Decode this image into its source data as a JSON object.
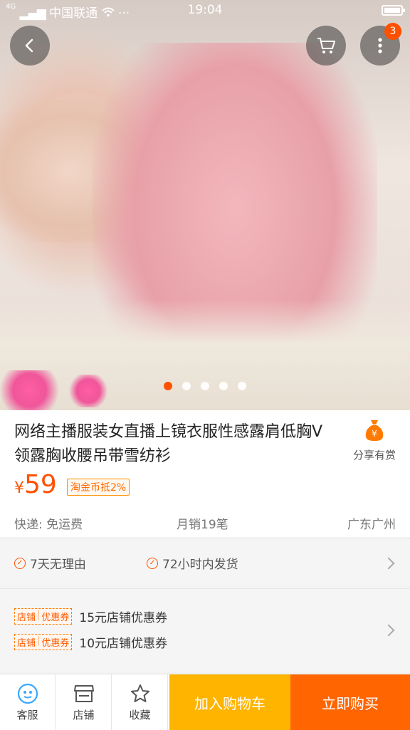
{
  "status_bar": {
    "carrier": "中国联通",
    "time": "19:04",
    "signal": "4G"
  },
  "header": {
    "cart_badge": "3"
  },
  "carousel": {
    "image_count": 5,
    "active_index": 0
  },
  "product": {
    "title": "网络主播服装女直播上镜衣服性感露肩低胸V领露胸收腰吊带雪纺衫",
    "currency_symbol": "¥",
    "price": "59",
    "coin_tag": "淘金币抵2%",
    "share_label": "分享有赏",
    "shipping": "快递: 免运费",
    "monthly_sales": "月销19笔",
    "location": "广东广州"
  },
  "guarantees": [
    {
      "label": "7天无理由"
    },
    {
      "label": "72小时内发货"
    }
  ],
  "coupons": {
    "tag_left": "店铺",
    "tag_right": "优惠券",
    "items": [
      {
        "label": "15元店铺优惠券"
      },
      {
        "label": "10元店铺优惠券"
      }
    ]
  },
  "bottom_bar": {
    "service": "客服",
    "shop": "店铺",
    "favorite": "收藏",
    "add_to_cart": "加入购物车",
    "buy_now": "立即购买"
  },
  "colors": {
    "accent": "#ff5000",
    "cart_button": "#ffb400",
    "buy_button": "#ff6500"
  }
}
